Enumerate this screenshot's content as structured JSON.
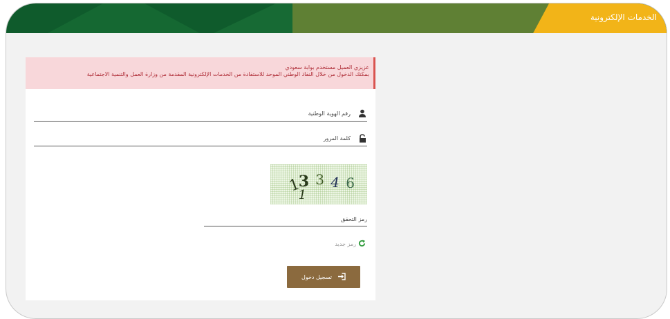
{
  "header": {
    "title": "الخدمات الإلكترونية",
    "colors": {
      "dark_green": "#0f5b2c",
      "olive": "#5f8034",
      "gold": "#f2b418"
    }
  },
  "alert": {
    "line1": "عزيزي العميل مستخدم بوابة سعودي",
    "line2": "بمكنك الدخول من خلال النفاذ الوطني الموحد للاستفادة من الخدمات الإلكترونية المقدمة من وزارة العمل والتنمية الاجتماعية"
  },
  "form": {
    "id_placeholder": "رقم الهوية الوطنية",
    "password_placeholder": "كلمة المرور",
    "captcha_text": "13 1 346",
    "captcha_placeholder": "رمز التحقق",
    "refresh_label": "رمز جديد",
    "login_label": "تسجيل دخول"
  },
  "icons": {
    "id": "user-icon",
    "password": "unlock-icon",
    "refresh": "refresh-icon",
    "login": "sign-in-icon"
  }
}
